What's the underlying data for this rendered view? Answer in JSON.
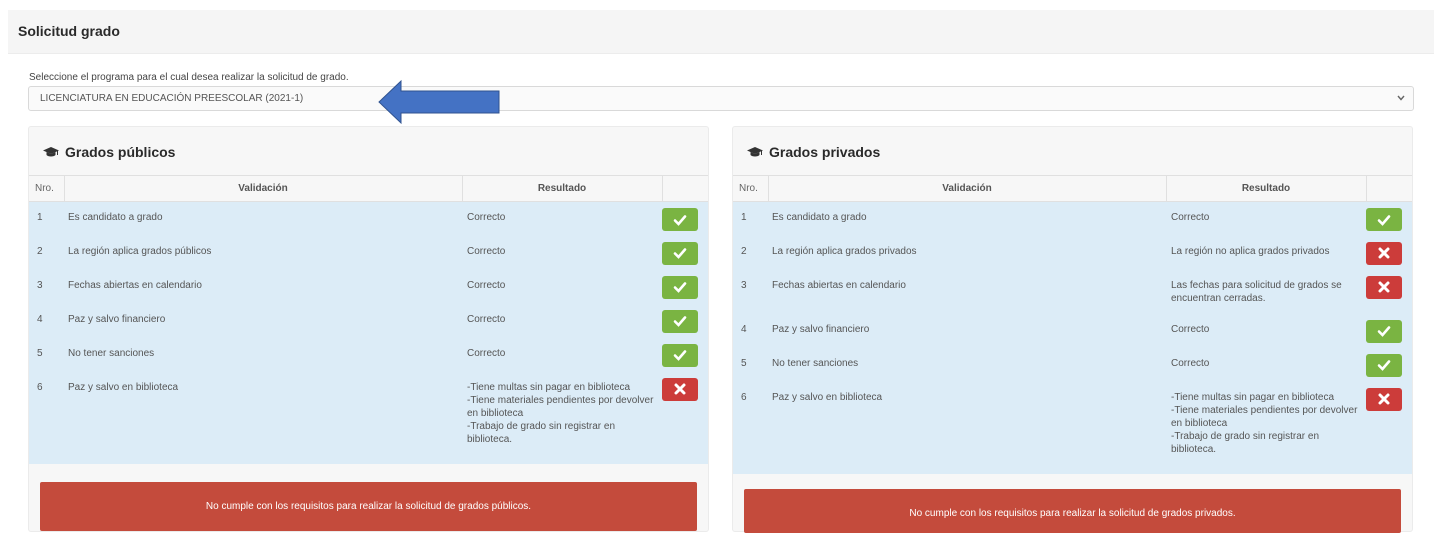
{
  "page": {
    "title": "Solicitud grado"
  },
  "program": {
    "label": "Seleccione el programa para el cual desea realizar la solicitud de grado.",
    "selected": "LICENCIATURA EN EDUCACIÓN PREESCOLAR (2021-1)"
  },
  "publicos": {
    "title": "Grados públicos",
    "headers": {
      "nro": "Nro.",
      "validacion": "Validación",
      "resultado": "Resultado"
    },
    "rows": [
      {
        "nro": "1",
        "validacion": "Es candidato a grado",
        "resultado": "Correcto",
        "status": "ok"
      },
      {
        "nro": "2",
        "validacion": "La región aplica grados públicos",
        "resultado": "Correcto",
        "status": "ok"
      },
      {
        "nro": "3",
        "validacion": "Fechas abiertas en calendario",
        "resultado": "Correcto",
        "status": "ok"
      },
      {
        "nro": "4",
        "validacion": "Paz y salvo financiero",
        "resultado": "Correcto",
        "status": "ok"
      },
      {
        "nro": "5",
        "validacion": "No tener sanciones",
        "resultado": "Correcto",
        "status": "ok"
      },
      {
        "nro": "6",
        "validacion": "Paz y salvo en biblioteca",
        "resultado_lines": [
          "-Tiene multas sin pagar en biblioteca",
          "-Tiene materiales pendientes por devolver",
          "en biblioteca",
          "-Trabajo de grado sin registrar en",
          "biblioteca."
        ],
        "status": "bad"
      }
    ],
    "alert": "No cumple con los requisitos para realizar la solicitud de grados públicos."
  },
  "privados": {
    "title": "Grados privados",
    "headers": {
      "nro": "Nro.",
      "validacion": "Validación",
      "resultado": "Resultado"
    },
    "rows": [
      {
        "nro": "1",
        "validacion": "Es candidato a grado",
        "resultado": "Correcto",
        "status": "ok"
      },
      {
        "nro": "2",
        "validacion": "La región aplica grados privados",
        "resultado": "La región no aplica grados privados",
        "status": "bad"
      },
      {
        "nro": "3",
        "validacion": "Fechas abiertas en calendario",
        "resultado_lines": [
          "Las fechas para solicitud de grados se",
          "encuentran cerradas."
        ],
        "status": "bad"
      },
      {
        "nro": "4",
        "validacion": "Paz y salvo financiero",
        "resultado": "Correcto",
        "status": "ok"
      },
      {
        "nro": "5",
        "validacion": "No tener sanciones",
        "resultado": "Correcto",
        "status": "ok"
      },
      {
        "nro": "6",
        "validacion": "Paz y salvo en biblioteca",
        "resultado_lines": [
          "-Tiene multas sin pagar en biblioteca",
          "-Tiene materiales pendientes por devolver",
          "en biblioteca",
          "-Trabajo de grado sin registrar en",
          "biblioteca."
        ],
        "status": "bad"
      }
    ],
    "alert": "No cumple con los requisitos para realizar la solicitud de grados privados."
  },
  "icons": {
    "ok": "check-icon",
    "bad": "x-icon",
    "title": "graduation-cap-icon",
    "select": "chevron-down-icon"
  },
  "colors": {
    "ok": "#7ab442",
    "bad": "#cc3c3a",
    "alert": "#c44b3c",
    "row_bg": "#dcecf7",
    "arrow": "#4472c4"
  }
}
